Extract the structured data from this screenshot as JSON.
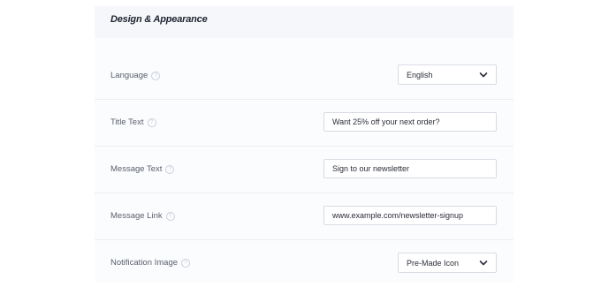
{
  "section": {
    "title": "Design & Appearance"
  },
  "fields": {
    "language": {
      "label": "Language",
      "value": "English"
    },
    "title_text": {
      "label": "Title Text",
      "value": "Want 25% off your next order?"
    },
    "message_text": {
      "label": "Message Text",
      "value": "Sign to our newsletter"
    },
    "message_link": {
      "label": "Message Link",
      "value": "www.example.com/newsletter-signup"
    },
    "notification_image": {
      "label": "Notification Image",
      "value": "Pre-Made Icon"
    }
  },
  "icons": {
    "help": "question-circle-icon",
    "dropdown": "chevron-down-icon"
  }
}
